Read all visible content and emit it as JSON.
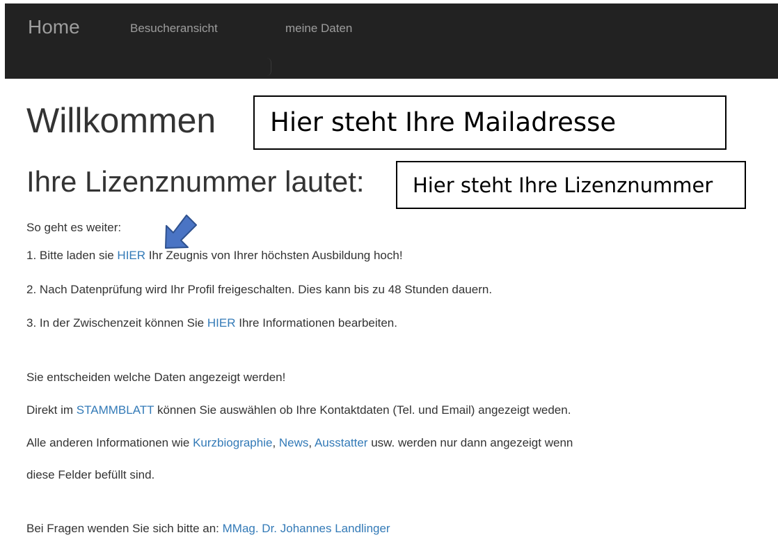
{
  "navbar": {
    "brand": "Home",
    "links": [
      "Besucheransicht",
      "meine Daten"
    ]
  },
  "welcome": {
    "title": "Willkommen",
    "mail_placeholder": "Hier steht Ihre Mailadresse"
  },
  "license": {
    "heading": "Ihre Lizenznummer lautet:",
    "placeholder": "Hier steht Ihre Lizenznummer"
  },
  "steps": {
    "intro": "So geht es weiter:",
    "step1": {
      "before": "1. Bitte laden sie ",
      "link": "HIER",
      "after": " Ihr Zeugnis von Ihrer höchsten Ausbildung hoch!"
    },
    "step2": "2. Nach Datenprüfung wird Ihr Profil freigeschalten. Dies kann bis zu 48 Stunden dauern.",
    "step3": {
      "before": "3. In der Zwischenzeit können Sie ",
      "link": "HIER",
      "after": " Ihre Informationen bearbeiten."
    }
  },
  "info": {
    "line1": "Sie entscheiden welche Daten angezeigt werden!",
    "line2": {
      "before": "Direkt im ",
      "link": "STAMMBLATT",
      "after": " können Sie auswählen ob Ihre Kontaktdaten (Tel. und Email) angezeigt weden."
    },
    "line3": {
      "before": "Alle anderen Informationen wie ",
      "link1": "Kurzbiographie",
      "sep1": ", ",
      "link2": "News",
      "sep2": ", ",
      "link3": "Ausstatter",
      "after": " usw. werden nur dann angezeigt wenn"
    },
    "line4": "diese Felder befüllt sind."
  },
  "contact": {
    "before": "Bei Fragen wenden Sie sich bitte an: ",
    "link": "MMag. Dr. Johannes Landlinger"
  },
  "colors": {
    "navbar_bg": "#222222",
    "nav_text": "#9d9d9d",
    "link": "#337ab7",
    "arrow": "#4a74c4"
  },
  "icons": {
    "pointer": "arrow-down-left-icon"
  }
}
